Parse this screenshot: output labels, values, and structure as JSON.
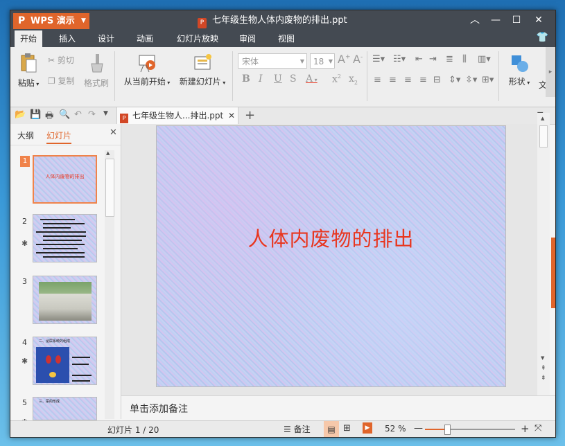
{
  "app": {
    "name": "WPS 演示",
    "logo": "P"
  },
  "window": {
    "title": "七年级生物人体内废物的排出.ppt"
  },
  "menu": {
    "tabs": [
      "开始",
      "插入",
      "设计",
      "动画",
      "幻灯片放映",
      "审阅",
      "视图"
    ],
    "active": "开始"
  },
  "ribbon": {
    "paste": "粘贴",
    "cut": "剪切",
    "copy": "复制",
    "format_painter": "格式刷",
    "from_current": "从当前开始",
    "new_slide": "新建幻灯片",
    "font_name": "宋体",
    "font_size": "18",
    "shape": "形状",
    "text_partial": "文"
  },
  "doc_tab": {
    "label": "七年级生物人...排出.ppt",
    "add": "+"
  },
  "left_panel": {
    "tab_outline": "大纲",
    "tab_slides": "幻灯片",
    "thumbnails": [
      {
        "num": "1",
        "title": "人体内废物的排出"
      },
      {
        "num": "2"
      },
      {
        "num": "3"
      },
      {
        "num": "4",
        "heading": "二、泌尿系统的组成"
      },
      {
        "num": "5",
        "heading": "三、尿的形成"
      }
    ]
  },
  "slide": {
    "title": "人体内废物的排出"
  },
  "notes": {
    "placeholder": "单击添加备注"
  },
  "status": {
    "slide_info": "幻灯片 1 / 20",
    "notes_btn": "备注",
    "zoom": "52 %"
  },
  "colors": {
    "accent": "#e0652b",
    "title_red": "#e8361f",
    "titlebar": "#444a52"
  }
}
